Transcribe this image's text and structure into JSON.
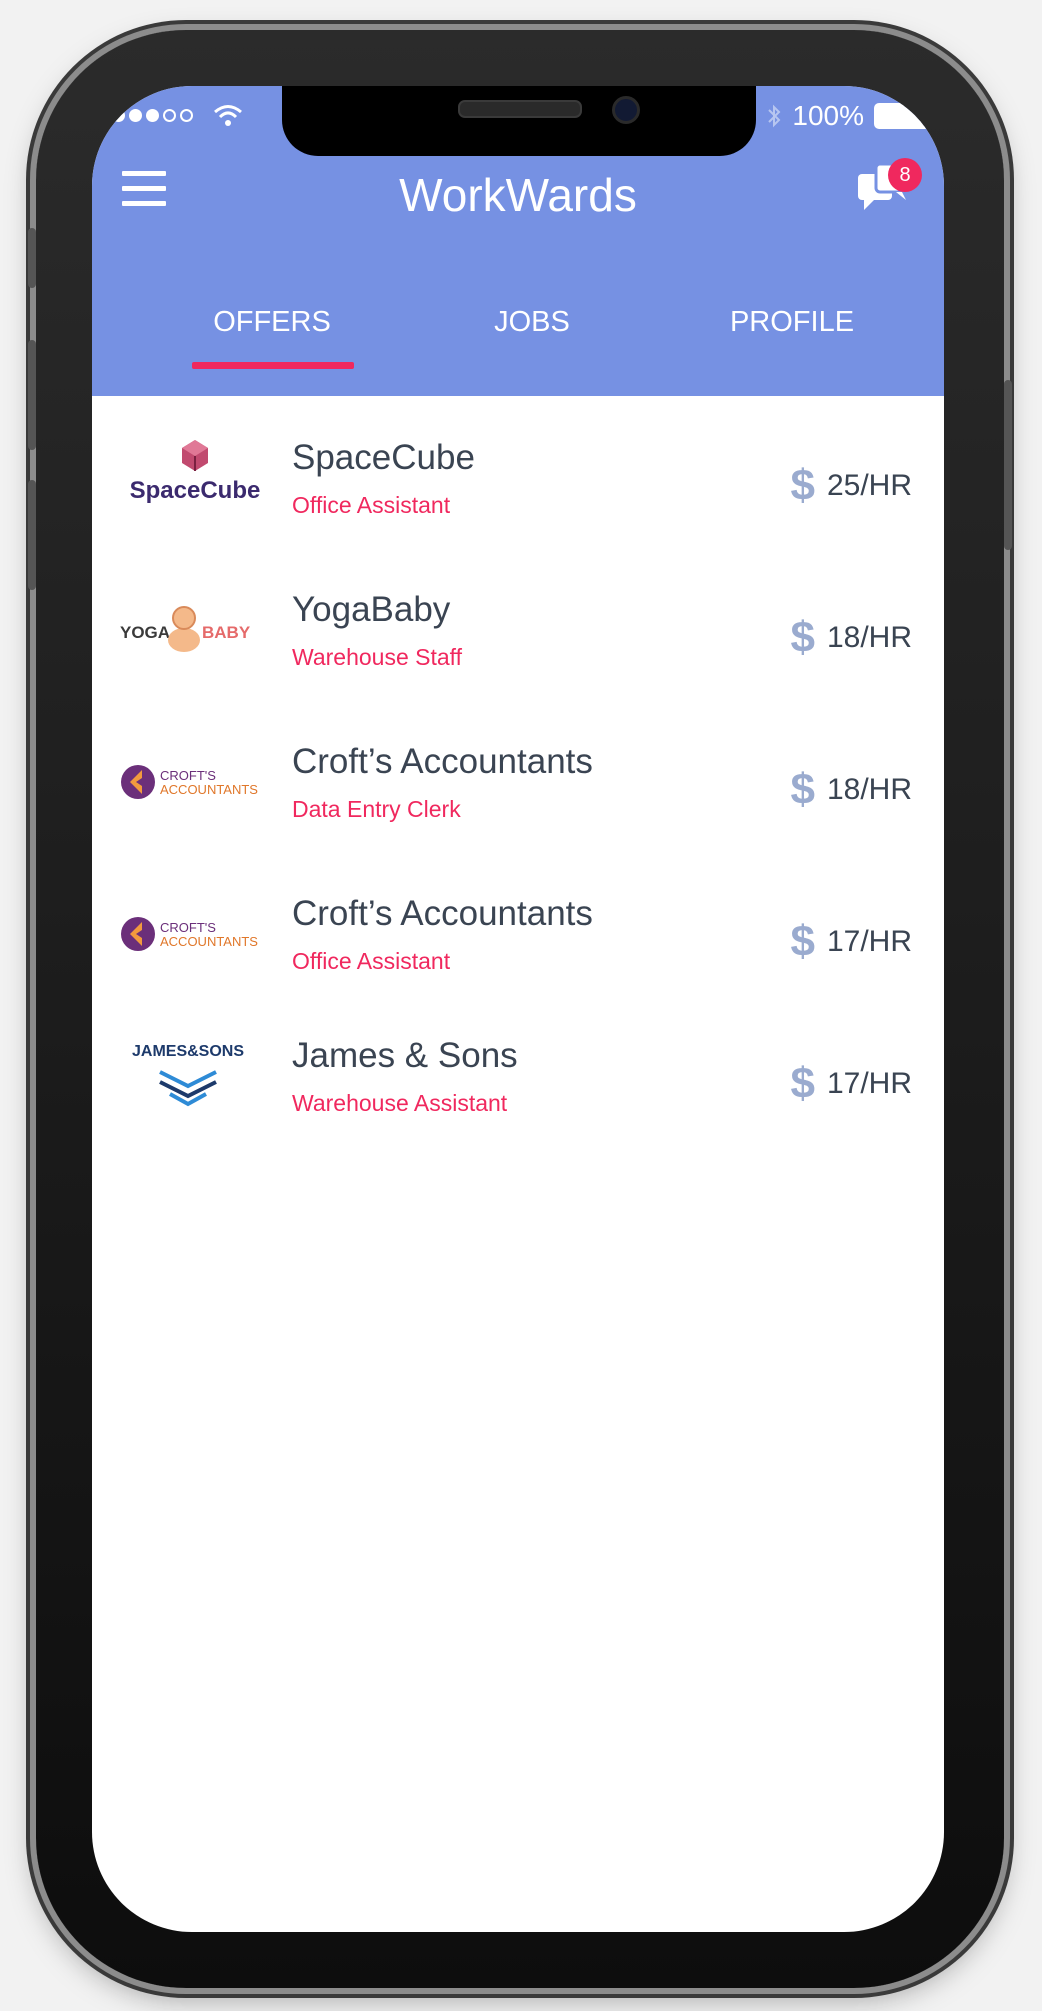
{
  "status_bar": {
    "battery": "100%",
    "signal_icon": "signal-dots-icon",
    "wifi_icon": "wifi-icon",
    "bluetooth_icon": "bluetooth-icon",
    "battery_icon": "battery-icon"
  },
  "header": {
    "title": "WorkWards",
    "menu_icon": "hamburger-menu-icon",
    "chat_icon": "chat-bubbles-icon",
    "notification_count": "8"
  },
  "tabs": [
    {
      "label": "OFFERS",
      "active": true
    },
    {
      "label": "JOBS",
      "active": false
    },
    {
      "label": "PROFILE",
      "active": false
    }
  ],
  "offers": [
    {
      "company": "SpaceCube",
      "role": "Office Assistant",
      "rate": "25/HR",
      "logo_text": "SpaceCube",
      "logo_icon": "spacecube-logo"
    },
    {
      "company": "YogaBaby",
      "role": "Warehouse Staff",
      "rate": "18/HR",
      "logo_text": "YOGA BABY",
      "logo_icon": "yogababy-logo"
    },
    {
      "company": "Croft’s Accountants",
      "role": "Data Entry Clerk",
      "rate": "18/HR",
      "logo_text": "CROFT'S ACCOUNTANTS",
      "logo_icon": "crofts-logo"
    },
    {
      "company": "Croft’s Accountants",
      "role": "Office Assistant",
      "rate": "17/HR",
      "logo_text": "CROFT'S ACCOUNTANTS",
      "logo_icon": "crofts-logo"
    },
    {
      "company": "James & Sons",
      "role": "Warehouse Assistant",
      "rate": "17/HR",
      "logo_text": "JAMES&SONS",
      "logo_icon": "james-sons-logo"
    }
  ],
  "colors": {
    "header_bg": "#7691e3",
    "accent": "#f0285e",
    "text_dark": "#3a4452",
    "dollar": "#9aabcf"
  }
}
